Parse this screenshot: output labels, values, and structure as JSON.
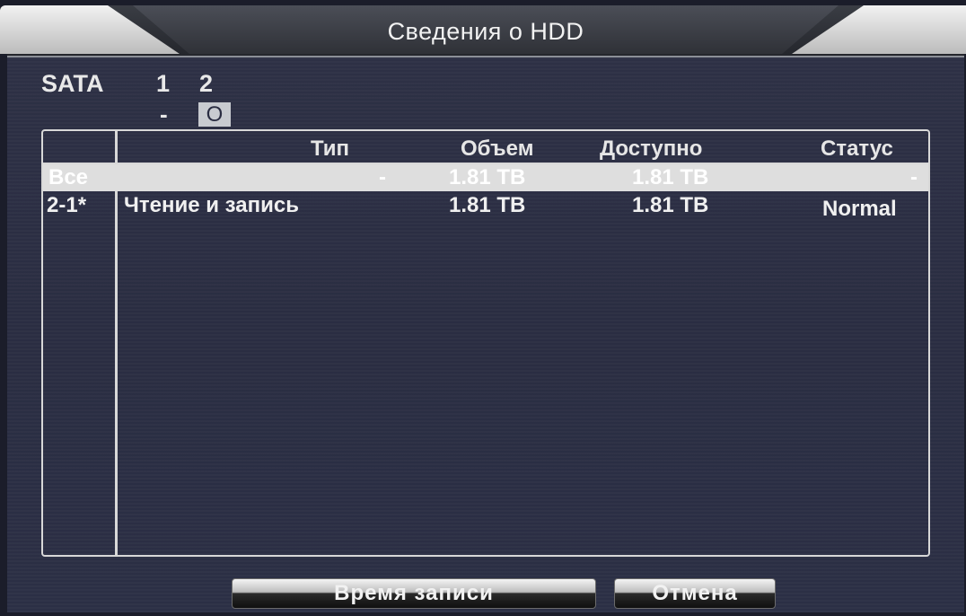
{
  "window": {
    "title": "Сведения о HDD"
  },
  "sata": {
    "label": "SATA",
    "disks": [
      "1",
      "2"
    ],
    "disk_states": [
      "-",
      "O"
    ],
    "selected_disk": "2"
  },
  "table": {
    "columns": [
      "Тип",
      "Объем",
      "Доступно",
      "Статус"
    ],
    "rows": [
      {
        "id": "Все",
        "type": "-",
        "capacity": "1.81 TB",
        "available": "1.81 TB",
        "status": "-",
        "selected": true
      },
      {
        "id": "2-1*",
        "type": "Чтение и запись",
        "capacity": "1.81 TB",
        "available": "1.81 TB",
        "status": "Normal",
        "selected": false
      }
    ]
  },
  "buttons": {
    "record_time": "Время записи",
    "cancel": "Отмена"
  }
}
